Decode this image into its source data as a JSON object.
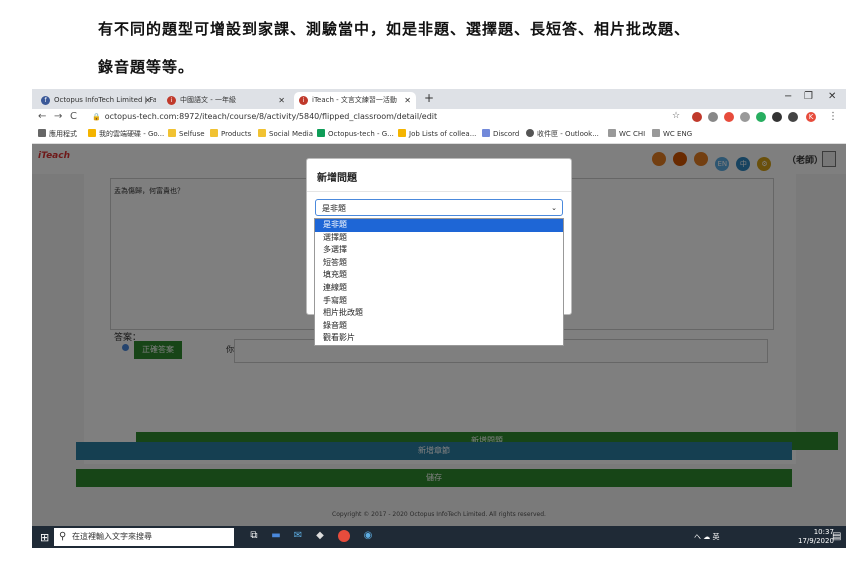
{
  "caption": {
    "line1": "有不同的題型可增設到家課、測驗當中，如是非題、選擇題、長短答、相片批改題、",
    "line2": "錄音題等等。"
  },
  "browser": {
    "tabs": [
      {
        "label": "Octopus InfoTech Limited | Fac",
        "icon": "facebook-icon",
        "color": "#3b5998"
      },
      {
        "label": "中國語文 - 一年級",
        "icon": "iteach-icon",
        "color": "#c0392b"
      },
      {
        "label": "iTeach - 文言文練習一活動",
        "icon": "iteach-icon",
        "color": "#c0392b"
      }
    ],
    "new_tab": "+",
    "window_controls": {
      "minimize": "−",
      "maximize": "❐",
      "close": "✕"
    },
    "url": "octopus-tech.com:8972/iteach/course/8/activity/5840/flipped_classroom/detail/edit",
    "bookmarks": [
      {
        "label": "應用程式",
        "color": "#666"
      },
      {
        "label": "我的雲端硬碟 - Go...",
        "color": "#f4b400"
      },
      {
        "label": "Selfuse",
        "color": "#f1c232"
      },
      {
        "label": "Products",
        "color": "#f1c232"
      },
      {
        "label": "Social Media",
        "color": "#f1c232"
      },
      {
        "label": "Octopus-tech - G...",
        "color": "#0f9d58"
      },
      {
        "label": "Job Lists of collea...",
        "color": "#f4b400"
      },
      {
        "label": "Discord",
        "color": "#7289da"
      },
      {
        "label": "收件匣 - Outlook...",
        "color": "#555"
      },
      {
        "label": "WC CHI",
        "color": "#999"
      },
      {
        "label": "WC ENG",
        "color": "#999"
      }
    ]
  },
  "app": {
    "logo": "iTeach",
    "teacher_label": "（老師）",
    "question_text": "孟為傷歸，何富貴也？",
    "answer_label": "答案：",
    "correct_answer_button": "正確答案",
    "answer_you": "你",
    "add_question_button": "新增問題",
    "add_chapter_button": "新增章節",
    "save_button": "儲存",
    "copyright": "Copyright © 2017 - 2020 Octopus InfoTech Limited. All rights reserved."
  },
  "modal": {
    "title": "新增問題",
    "selected_value": "是非題",
    "options": [
      "是非題",
      "選擇題",
      "多選擇",
      "短答題",
      "填充題",
      "連線題",
      "手寫題",
      "相片批改題",
      "錄音題",
      "觀看影片"
    ]
  },
  "taskbar": {
    "search_placeholder": "在這裡輸入文字來搜尋",
    "tray_text": "へ ☁ 英",
    "time": "10:37",
    "date": "17/9/2020"
  }
}
